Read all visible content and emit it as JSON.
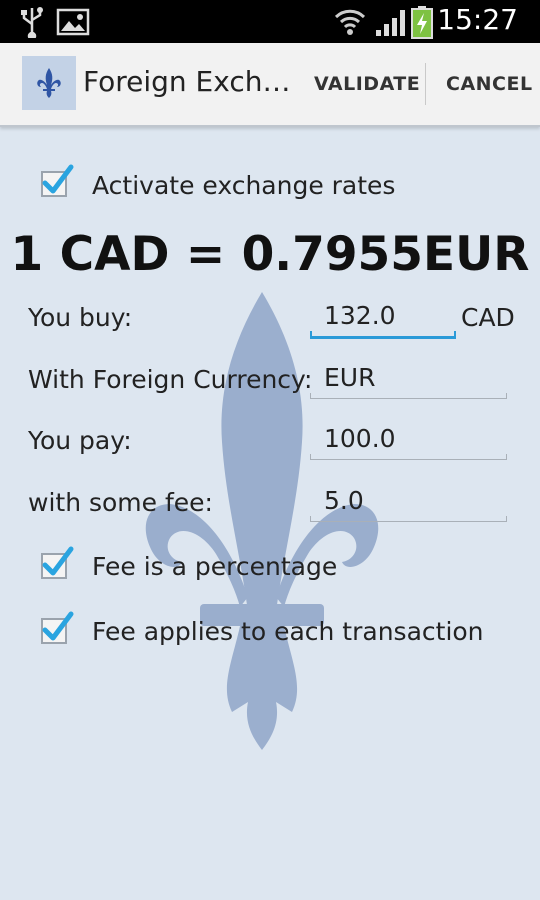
{
  "status_bar": {
    "time": "15:27"
  },
  "action_bar": {
    "title": "Foreign Exch…",
    "validate_label": "VALIDATE",
    "cancel_label": "CANCEL"
  },
  "form": {
    "activate_label": "Activate exchange rates",
    "activate_checked": true,
    "rate_text": "1 CAD = 0.7955EUR",
    "buy_label": "You buy:",
    "buy_value": "132.0",
    "buy_unit": "CAD",
    "currency_label": "With Foreign Currency:",
    "currency_value": "EUR",
    "pay_label": "You pay:",
    "pay_value": "100.0",
    "fee_label": "with some fee:",
    "fee_value": "5.0",
    "fee_percentage_label": "Fee is a percentage",
    "fee_percentage_checked": true,
    "fee_each_label": "Fee applies to each transaction",
    "fee_each_checked": true
  },
  "colors": {
    "accent": "#2a9ad8",
    "checkmark": "#2aa4e0",
    "background": "#dde6f0",
    "fleur": "#8fa5c8"
  }
}
